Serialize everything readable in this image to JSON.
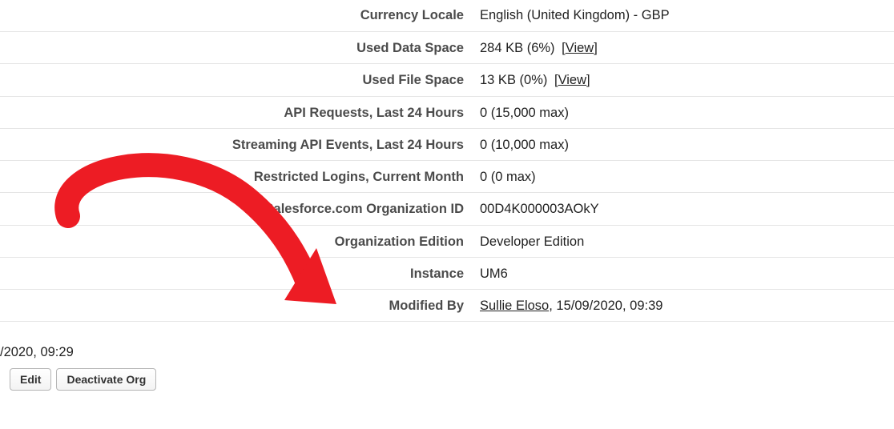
{
  "rows": {
    "currency_locale": {
      "label": "Currency Locale",
      "value": "English (United Kingdom) - GBP"
    },
    "used_data_space": {
      "label": "Used Data Space",
      "value": "284 KB (6%)",
      "view": "View"
    },
    "used_file_space": {
      "label": "Used File Space",
      "value": "13 KB (0%)",
      "view": "View"
    },
    "api_requests": {
      "label": "API Requests, Last 24 Hours",
      "value": "0 (15,000 max)"
    },
    "streaming_api": {
      "label": "Streaming API Events, Last 24 Hours",
      "value": "0 (10,000 max)"
    },
    "restricted_logins": {
      "label": "Restricted Logins, Current Month",
      "value": "0 (0 max)"
    },
    "org_id": {
      "label": "Salesforce.com Organization ID",
      "value": "00D4K000003AOkY"
    },
    "org_edition": {
      "label": "Organization Edition",
      "value": "Developer Edition"
    },
    "instance": {
      "label": "Instance",
      "value": "UM6"
    },
    "modified_by": {
      "label": "Modified By",
      "user": "Sullie Eloso",
      "timestamp": ", 15/09/2020, 09:39"
    }
  },
  "created_fragment": "/2020, 09:29",
  "buttons": {
    "edit": "Edit",
    "deactivate": "Deactivate Org"
  }
}
